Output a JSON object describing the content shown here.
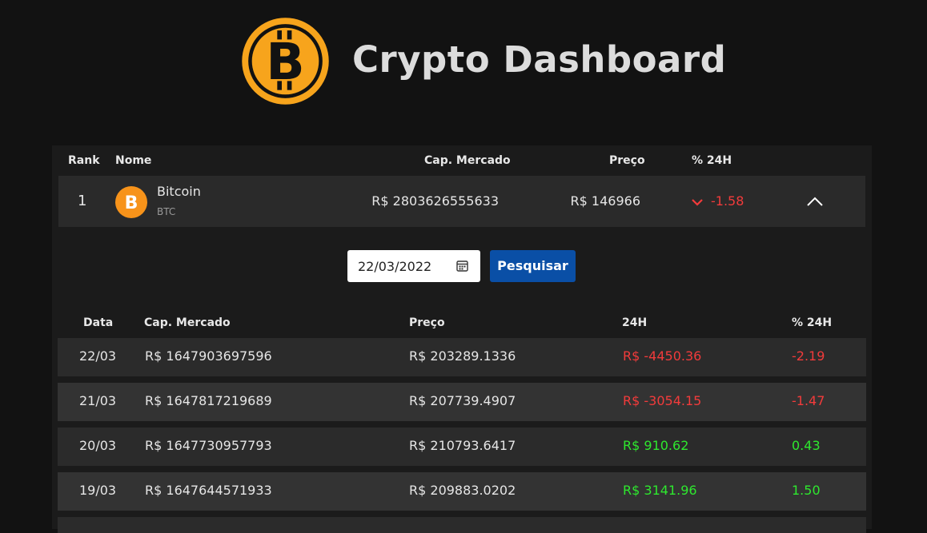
{
  "header": {
    "title": "Crypto Dashboard",
    "logo_icon": "bitcoin-logo-icon"
  },
  "table": {
    "columns": {
      "rank": "Rank",
      "name": "Nome",
      "market_cap": "Cap. Mercado",
      "price": "Preço",
      "change": "% 24H"
    },
    "coin": {
      "rank": "1",
      "name": "Bitcoin",
      "symbol": "BTC",
      "market_cap": "R$ 2803626555633",
      "price": "R$ 146966",
      "change": "-1.58",
      "change_icon": "chevron-down-icon",
      "toggle_icon": "chevron-up-icon"
    }
  },
  "filter": {
    "date_value": "22/03/2022",
    "search_label": "Pesquisar"
  },
  "history": {
    "columns": {
      "date": "Data",
      "market_cap": "Cap. Mercado",
      "price": "Preço",
      "h24": "24H",
      "pct": "% 24H"
    },
    "rows": [
      {
        "date": "22/03",
        "market_cap": "R$ 1647903697596",
        "price": "R$ 203289.1336",
        "h24": "R$ -4450.36",
        "pct": "-2.19"
      },
      {
        "date": "21/03",
        "market_cap": "R$ 1647817219689",
        "price": "R$ 207739.4907",
        "h24": "R$ -3054.15",
        "pct": "-1.47"
      },
      {
        "date": "20/03",
        "market_cap": "R$ 1647730957793",
        "price": "R$ 210793.6417",
        "h24": "R$ 910.62",
        "pct": "0.43"
      },
      {
        "date": "19/03",
        "market_cap": "R$ 1647644571933",
        "price": "R$ 209883.0202",
        "h24": "R$ 3141.96",
        "pct": "1.50"
      }
    ]
  },
  "colors": {
    "negative": "#f23b3b",
    "positive": "#2ee82e",
    "accent": "#0a4fa6",
    "bitcoin": "#f7931a"
  }
}
